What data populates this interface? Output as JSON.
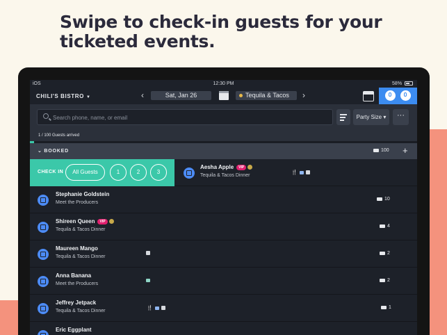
{
  "headline": "Swipe to check-in guests for your ticketed events.",
  "status_bar": {
    "carrier": "iOS ",
    "wifi": "wifi",
    "time": "12:30 PM",
    "bluetooth": "bt",
    "battery": "58%",
    "battery_level": 0.58
  },
  "header": {
    "venue": "CHILI'S BISTRO",
    "date": "Sat, Jan 26",
    "event": "Tequila & Tacos",
    "prev_icon": "chevron-left-icon",
    "next_icon": "chevron-right-icon"
  },
  "search": {
    "placeholder": "Search phone, name, or email",
    "party_size_label": "Party Size",
    "more_label": "···"
  },
  "progress": {
    "label": "1 / 100 Guests arrived",
    "arrived": 1,
    "total": 100
  },
  "booked": {
    "label": "BOOKED",
    "count": "100"
  },
  "checkin": {
    "label": "CHECK IN",
    "filters": [
      "All Guests",
      "1",
      "2",
      "3"
    ]
  },
  "guests": [
    {
      "name": "Aesha Apple",
      "event": "Tequila & Tacos Dinner",
      "vip": "VIP",
      "count": ""
    },
    {
      "name": "Stephanie Goldstein",
      "event": "Meet the Producers",
      "vip": "",
      "count": "10"
    },
    {
      "name": "Shireen Queen",
      "event": "Tequila & Tacos Dinner",
      "vip": "VIP",
      "count": "4"
    },
    {
      "name": "Maureen Mango",
      "event": "Tequila & Tacos Dinner",
      "vip": "",
      "count": "2"
    },
    {
      "name": "Anna Banana",
      "event": "Meet the Producers",
      "vip": "",
      "count": "2"
    },
    {
      "name": "Jeffrey Jetpack",
      "event": "Tequila & Tacos Dinner",
      "vip": "",
      "count": "1"
    },
    {
      "name": "Eric Eggplant",
      "event": "",
      "vip": "",
      "count": ""
    }
  ],
  "colors": {
    "accent_green": "#3bc8a9",
    "accent_blue": "#3c8cf0",
    "coral": "#f4927d",
    "vip_pink": "#e0206e"
  }
}
